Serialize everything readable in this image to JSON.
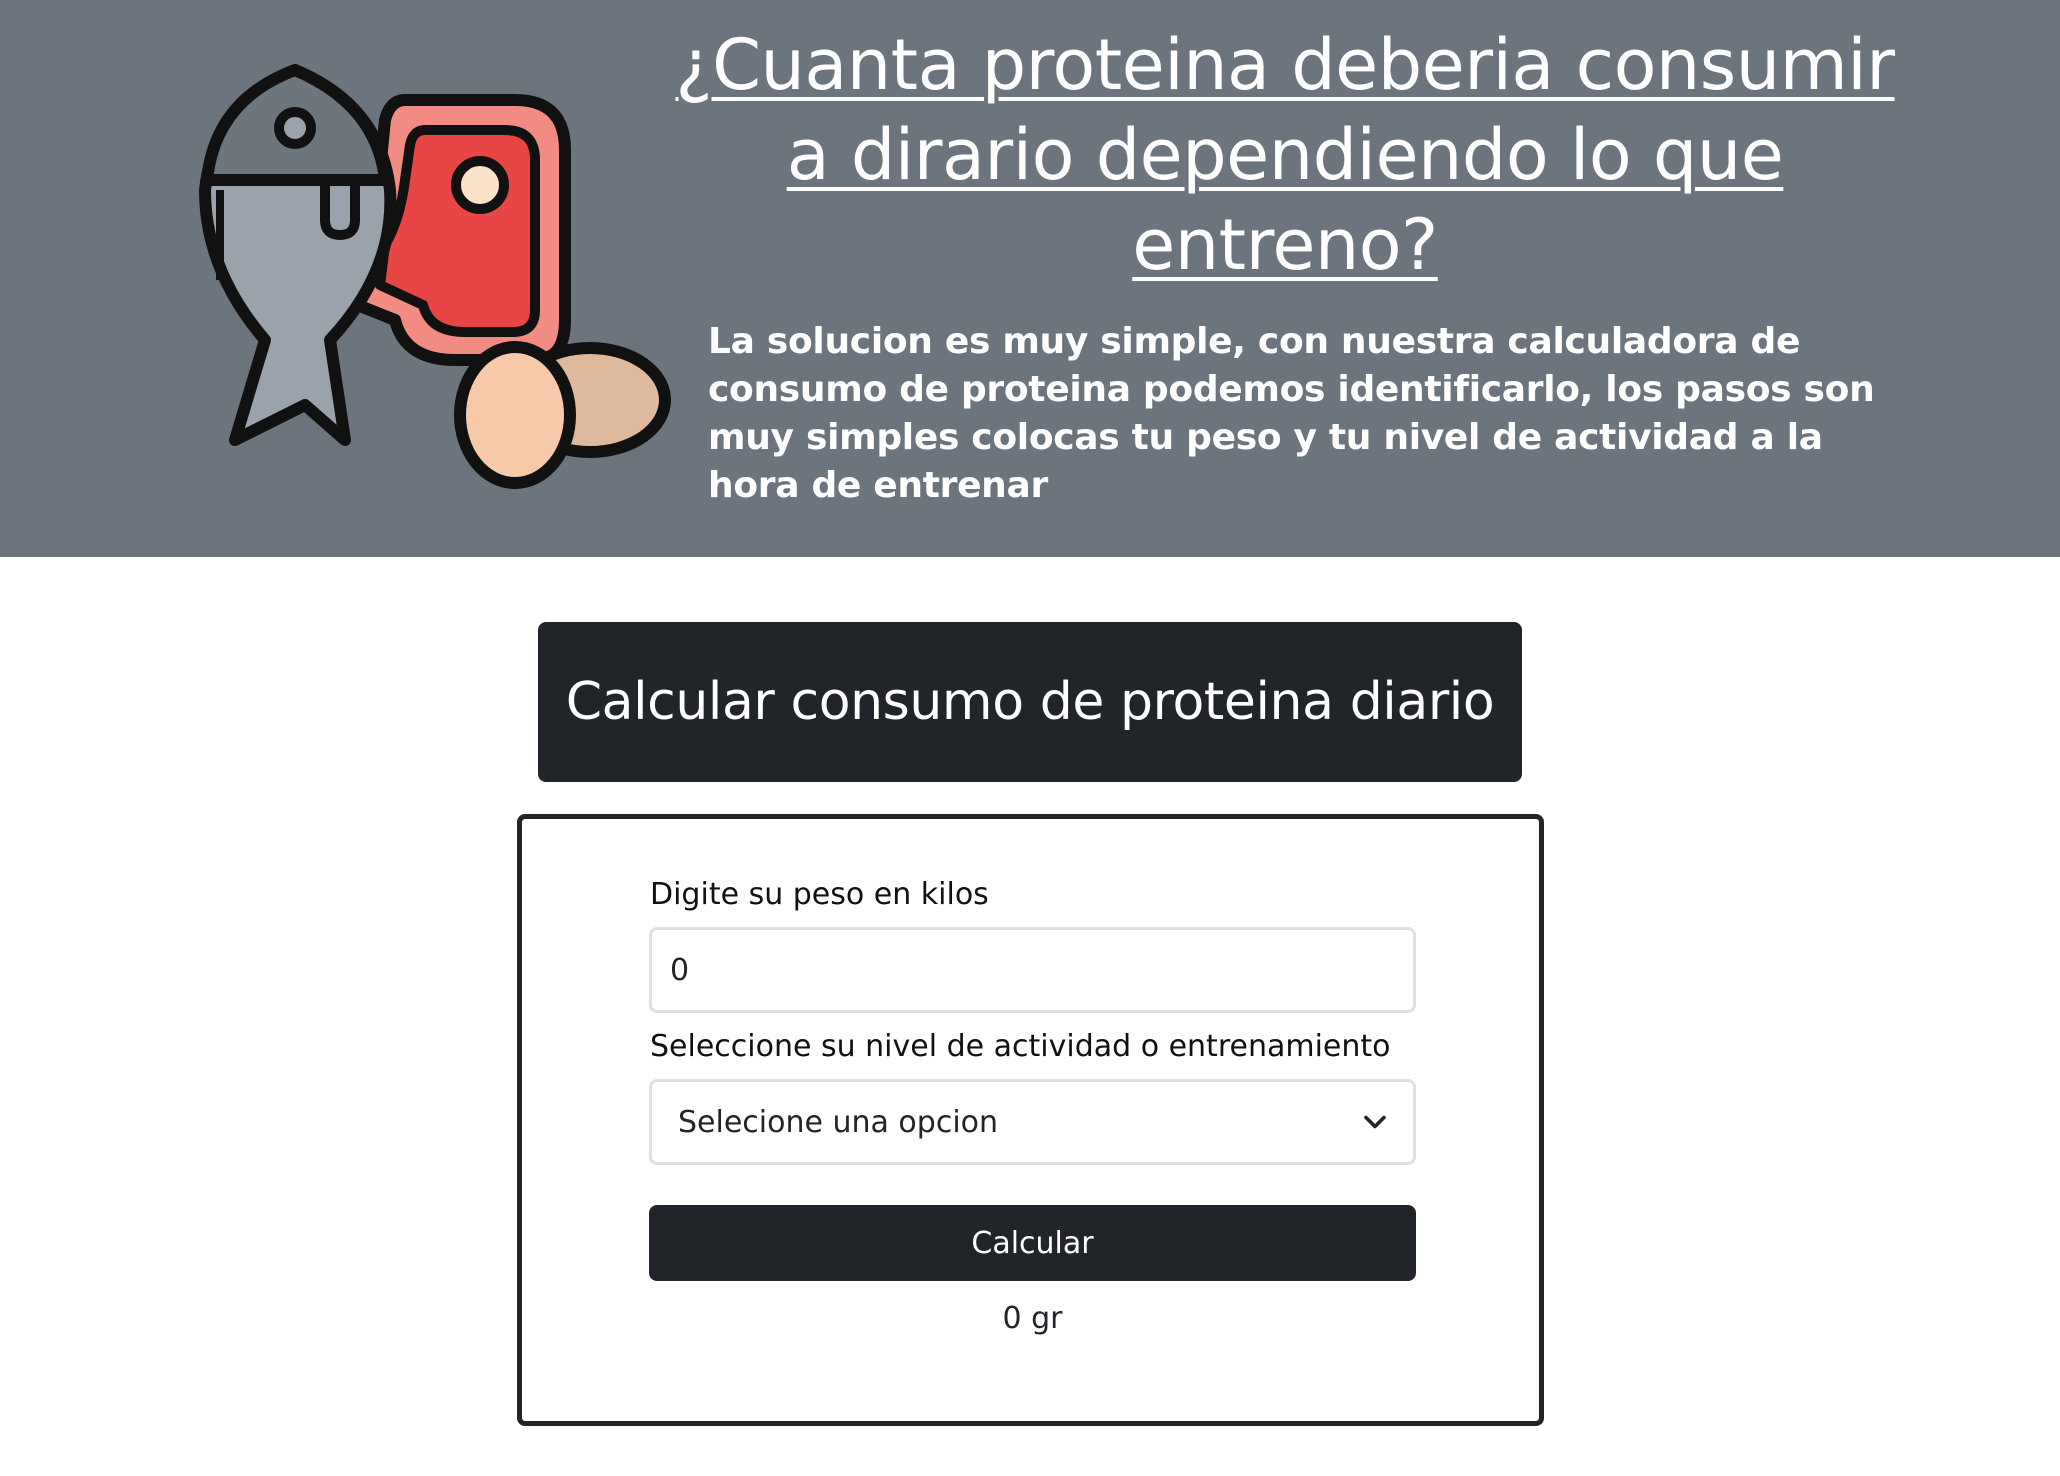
{
  "hero": {
    "title": "¿Cuanta proteina deberia consumir a dirario dependiendo lo que entreno?",
    "description": "La solucion es muy simple, con nuestra calculadora de consumo de proteina podemos identificarlo, los pasos son muy simples colocas tu peso y tu nivel de actividad a la hora de entrenar",
    "illustration": "protein-foods-illustration"
  },
  "calculator": {
    "header": "Calcular consumo de proteina diario",
    "weight_label": "Digite su peso en kilos",
    "weight_value": "0",
    "activity_label": "Seleccione su nivel de actividad o entrenamiento",
    "activity_selected": "Selecione una opcion",
    "button_label": "Calcular",
    "result": "0 gr"
  },
  "colors": {
    "hero_background": "#6c757d",
    "dark": "#212529",
    "meat": "#e84545",
    "fish": "#9aa3ab",
    "egg": "#f6c9a8"
  }
}
